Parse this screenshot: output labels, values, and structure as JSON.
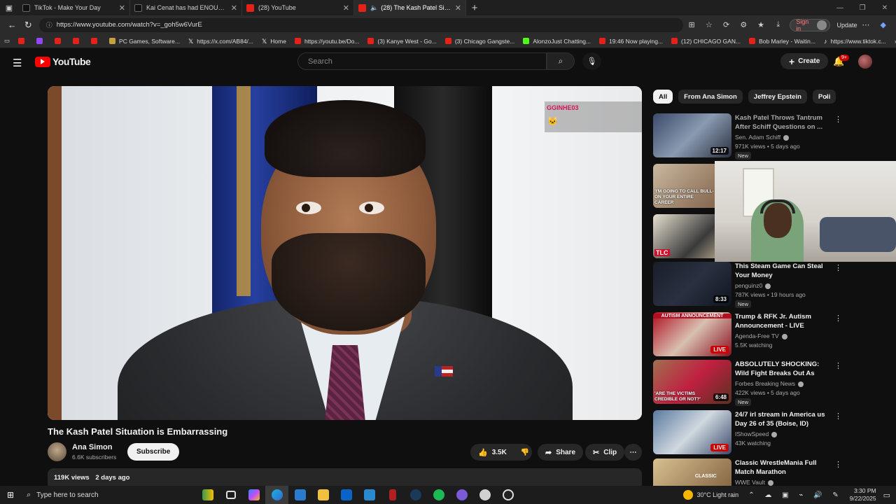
{
  "browser": {
    "tabs": [
      {
        "title": "TikTok - Make Your Day",
        "active": false,
        "favicon_color": "#111111"
      },
      {
        "title": "Kai Cenat has had ENOUGH of C...",
        "active": false,
        "favicon_color": "#111111"
      },
      {
        "title": "(28) YouTube",
        "active": false,
        "favicon_color": "#e62117"
      },
      {
        "title": "(28) The Kash Patel Situation...",
        "active": true,
        "favicon_color": "#e62117"
      }
    ],
    "url": "https://www.youtube.com/watch?v=_goh5w6VurE",
    "sign_in_label": "Sign in",
    "update_label": "Update",
    "bookmarks": [
      {
        "label": "",
        "icon": "youtube-icon"
      },
      {
        "label": "",
        "icon": "twitch-icon"
      },
      {
        "label": "",
        "icon": "youtube-icon"
      },
      {
        "label": "",
        "icon": "youtube-icon"
      },
      {
        "label": "",
        "icon": "youtube-icon"
      },
      {
        "label": "PC Games, Software...",
        "icon": "game-icon"
      },
      {
        "label": "https://x.com/AB84/...",
        "icon": "x-icon"
      },
      {
        "label": "Home",
        "icon": "x-icon"
      },
      {
        "label": "https://youtu.be/Do...",
        "icon": "youtube-icon"
      },
      {
        "label": "(3) Kanye West - Go...",
        "icon": "youtube-icon"
      },
      {
        "label": "(3) Chicago Gangste...",
        "icon": "youtube-icon"
      },
      {
        "label": "AlonzoJust Chatting...",
        "icon": "kick-icon"
      },
      {
        "label": "19:46 Now playing...",
        "icon": "youtube-icon"
      },
      {
        "label": "(12) CHICAGO GAN...",
        "icon": "youtube-icon"
      },
      {
        "label": "Bob Marley - Waitin...",
        "icon": "youtube-icon"
      },
      {
        "label": "https://www.tiktok.c...",
        "icon": "tiktok-icon"
      }
    ]
  },
  "youtube": {
    "logo_text": "YouTube",
    "search_placeholder": "Search",
    "create_label": "Create",
    "notification_count": "9+",
    "video": {
      "overlay_name": "GGINHE03",
      "title": "The Kash Patel Situation is Embarrassing",
      "channel": "Ana Simon",
      "subscribers": "6.6K subscribers",
      "subscribe_label": "Subscribe",
      "likes": "3.5K",
      "share_label": "Share",
      "clip_label": "Clip",
      "views": "119K views",
      "age": "2 days ago"
    },
    "chips": [
      "All",
      "From Ana Simon",
      "Jeffrey Epstein",
      "Poli"
    ],
    "recommendations": [
      {
        "title": "Kash Patel Throws Tantrum After Schiff Questions on ...",
        "channel": "Sen. Adam Schiff",
        "meta": "971K views • 5 days ago",
        "badge": "New",
        "duration": "12:17",
        "thumb": "linear-gradient(135deg,#3a4a6a,#8a9ab0 50%,#2a3040)"
      },
      {
        "title": "",
        "channel": "",
        "meta": "",
        "badge": "",
        "duration": "",
        "thumb_text": "'I'M GOING TO CALL BULL- ON YOUR ENTIRE CAREER",
        "thumb": "linear-gradient(135deg,#c9b8a0,#7a5a40)"
      },
      {
        "title": "",
        "channel": "",
        "meta": "",
        "badge": "",
        "duration": "",
        "thumb_text": "TLC",
        "thumb": "linear-gradient(135deg,#e8e0d0,#3a3a3a 60%,#d0c0a0)"
      },
      {
        "title": "This Steam Game Can Steal Your Money",
        "channel": "penguinz0",
        "meta": "787K views • 19 hours ago",
        "badge": "New",
        "duration": "8:33",
        "thumb": "linear-gradient(135deg,#1a1e2a,#2a3040 50%,#101420)"
      },
      {
        "title": "Trump & RFK Jr. Autism Announcement - LIVE Breakin...",
        "channel": "Agenda-Free TV",
        "meta": "5.5K watching",
        "badge": "",
        "duration": "",
        "live": "LIVE",
        "thumb_text": "AUTISM ANNOUNCEMENT",
        "thumb": "linear-gradient(135deg,#b01020,#d8c0b0 50%,#8a1020)"
      },
      {
        "title": "ABSOLUTELY SHOCKING: Wild Fight Breaks Out As Kash Pate...",
        "channel": "Forbes Breaking News",
        "meta": "422K views • 5 days ago",
        "badge": "New",
        "duration": "6:48",
        "thumb_text": "'ARE THE VICTIMS CREDIBLE OR NOT?'",
        "thumb": "linear-gradient(135deg,#a07050,#c02040 50%,#5a3020)"
      },
      {
        "title": "24/7 irl stream in America us Day 26 of 35 (Boise, ID)",
        "channel": "IShowSpeed",
        "meta": "43K watching",
        "badge": "",
        "duration": "",
        "live": "LIVE",
        "thumb": "linear-gradient(135deg,#5a7aa0,#d0d8e0 50%,#3a4a6a)"
      },
      {
        "title": "Classic WrestleMania Full Match Marathon",
        "channel": "WWE Vault",
        "meta": "",
        "badge": "",
        "duration": "",
        "thumb_text": "CLASSIC",
        "thumb": "linear-gradient(135deg,#d8c090,#7a5a3a)"
      }
    ]
  },
  "taskbar": {
    "search_placeholder": "Type here to search",
    "weather": "30°C  Light rain",
    "time": "3:30 PM",
    "date": "9/22/2025"
  }
}
